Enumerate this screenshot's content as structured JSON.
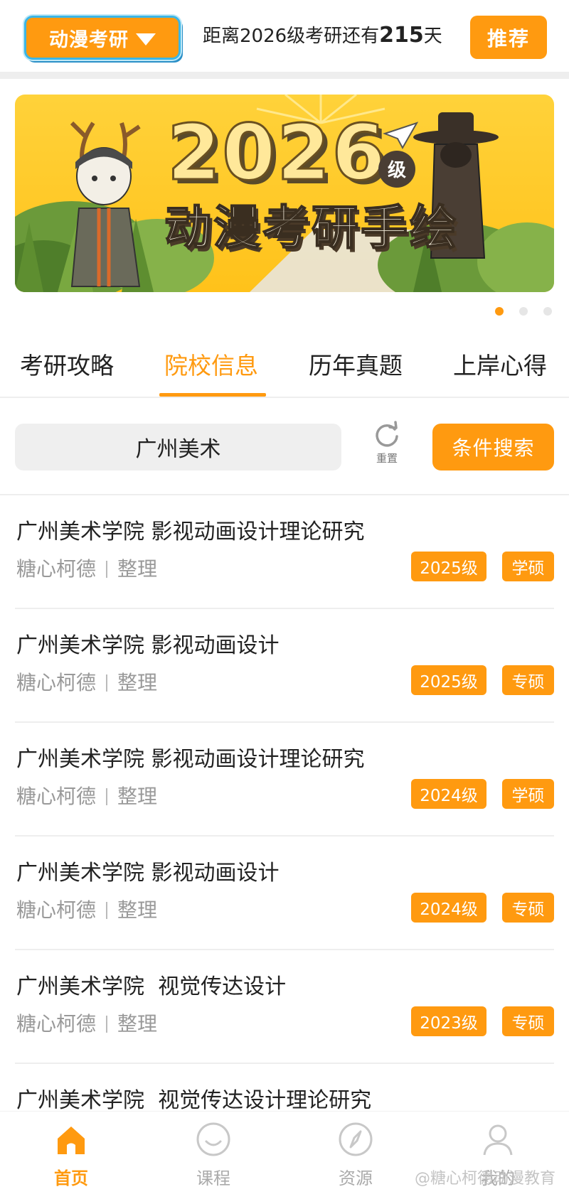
{
  "header": {
    "category_label": "动漫考研",
    "countdown_prefix": "距离2026级考研还有",
    "countdown_days": "215",
    "countdown_suffix": "天",
    "recommend_label": "推荐"
  },
  "banner": {
    "big_number": "2026",
    "grade_badge": "级",
    "title": "动漫考研手绘",
    "slide_count": 3,
    "active_slide": 1
  },
  "tabs": [
    {
      "label": "考研攻略",
      "active": false
    },
    {
      "label": "院校信息",
      "active": true
    },
    {
      "label": "历年真题",
      "active": false
    },
    {
      "label": "上岸心得",
      "active": false
    }
  ],
  "search": {
    "value": "广州美术",
    "reset_label": "重置",
    "filter_label": "条件搜索"
  },
  "items": [
    {
      "title": "广州美术学院 影视动画设计理论研究",
      "author": "糖心柯德",
      "role": "整理",
      "year": "2025级",
      "degree": "学硕"
    },
    {
      "title": "广州美术学院 影视动画设计",
      "author": "糖心柯德",
      "role": "整理",
      "year": "2025级",
      "degree": "专硕"
    },
    {
      "title": "广州美术学院 影视动画设计理论研究",
      "author": "糖心柯德",
      "role": "整理",
      "year": "2024级",
      "degree": "学硕"
    },
    {
      "title": "广州美术学院 影视动画设计",
      "author": "糖心柯德",
      "role": "整理",
      "year": "2024级",
      "degree": "专硕"
    },
    {
      "title": "广州美术学院  视觉传达设计",
      "author": "糖心柯德",
      "role": "整理",
      "year": "2023级",
      "degree": "专硕"
    },
    {
      "title": "广州美术学院  视觉传达设计理论研究",
      "author": "",
      "role": "",
      "year": "",
      "degree": ""
    }
  ],
  "bottom_nav": [
    {
      "label": "首页",
      "icon": "home-icon",
      "active": true
    },
    {
      "label": "课程",
      "icon": "smile-icon",
      "active": false
    },
    {
      "label": "资源",
      "icon": "compass-icon",
      "active": false
    },
    {
      "label": "我的",
      "icon": "user-icon",
      "active": false
    }
  ],
  "watermark": "@糖心柯德动漫教育",
  "colors": {
    "accent": "#ff9a10",
    "text": "#222222",
    "muted": "#999999",
    "divider": "#eeeeee"
  }
}
